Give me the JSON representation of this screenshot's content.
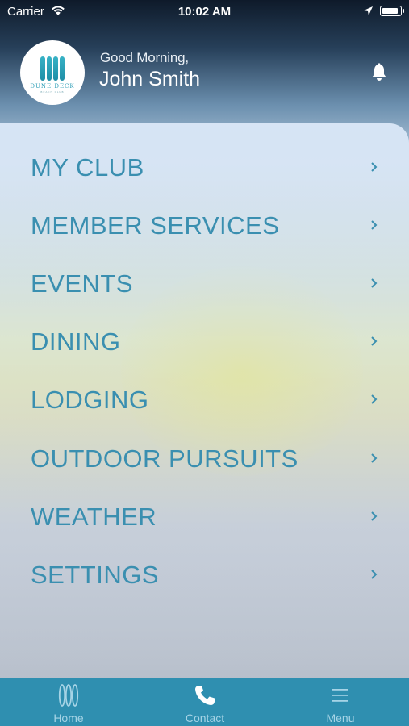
{
  "status_bar": {
    "carrier": "Carrier",
    "time": "10:02 AM",
    "battery_level": 0.95
  },
  "header": {
    "logo_text": "DUNE DECK",
    "logo_subtext": "BEACH CLUB",
    "greeting": "Good Morning,",
    "user_name": "John Smith",
    "bell_icon": "bell-icon"
  },
  "menu": {
    "items": [
      {
        "label": "MY CLUB"
      },
      {
        "label": "MEMBER SERVICES"
      },
      {
        "label": "EVENTS"
      },
      {
        "label": "DINING"
      },
      {
        "label": "LODGING"
      },
      {
        "label": "OUTDOOR PURSUITS"
      },
      {
        "label": "WEATHER"
      },
      {
        "label": "SETTINGS"
      }
    ],
    "chevron_icon": "chevron-right-icon",
    "label_color": "#3a8fb0"
  },
  "tab_bar": {
    "background": "#2f8fb0",
    "tabs": [
      {
        "label": "Home",
        "icon": "surfboards-icon"
      },
      {
        "label": "Contact",
        "icon": "phone-icon"
      },
      {
        "label": "Menu",
        "icon": "hamburger-menu-icon"
      }
    ]
  }
}
